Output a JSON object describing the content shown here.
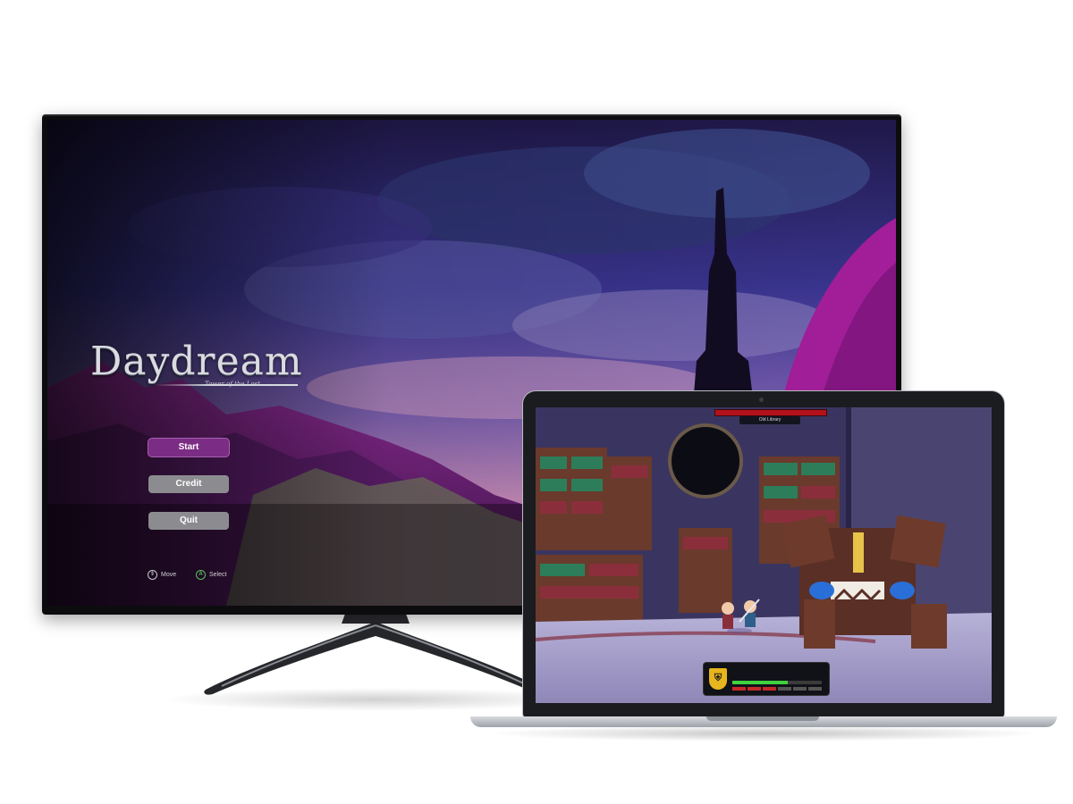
{
  "tv_game": {
    "title": "Daydream",
    "subtitle": "Tower of the Lost",
    "menu": [
      {
        "label": "Start",
        "selected": true
      },
      {
        "label": "Credit",
        "selected": false
      },
      {
        "label": "Quit",
        "selected": false
      }
    ],
    "hints": [
      {
        "icon": "dpad-updown-icon",
        "glyph": "⇕",
        "label": "Move"
      },
      {
        "icon": "a-button-icon",
        "glyph": "A",
        "label": "Select"
      }
    ],
    "colors": {
      "selected": "#7b2c84",
      "idle": "#8c8c90",
      "accent_mountain": "#a31e9a"
    }
  },
  "laptop_game": {
    "area_name": "Old Library",
    "boss_health": 1.0,
    "hud": {
      "shield_glyph": "⛨",
      "health": 0.62,
      "heart_slots": [
        "#c62828",
        "#c62828",
        "#c62828",
        "#555555",
        "#555555",
        "#555555"
      ]
    }
  }
}
